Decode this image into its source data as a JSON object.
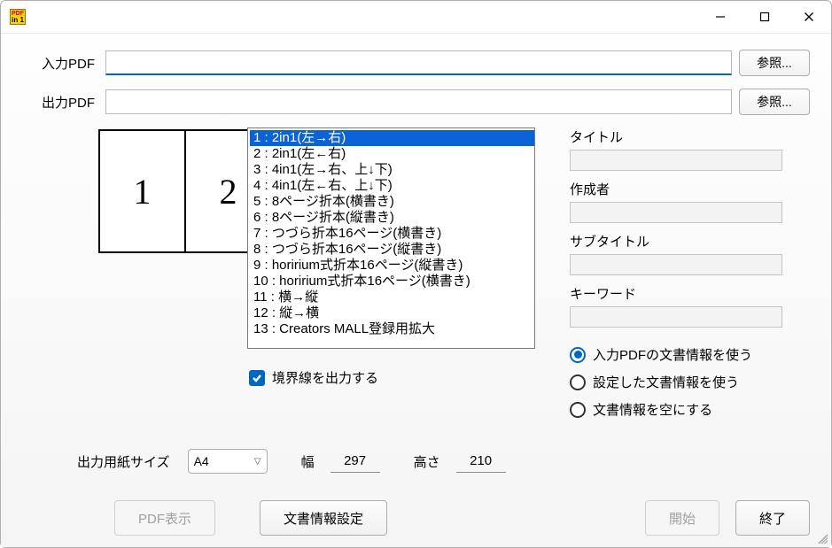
{
  "window": {
    "app_icon_top": "PDF",
    "app_icon_bottom": "in 1"
  },
  "file": {
    "input_label": "入力PDF",
    "output_label": "出力PDF",
    "input_value": "",
    "output_value": "",
    "browse_label": "参照..."
  },
  "preview": {
    "cells": [
      "1",
      "2"
    ]
  },
  "layouts": {
    "selected_index": 0,
    "items": [
      "1 : 2in1(左→右)",
      "2 : 2in1(左←右)",
      "3 : 4in1(左→右、上↓下)",
      "4 : 4in1(左←右、上↓下)",
      "5 : 8ページ折本(横書き)",
      "6 : 8ページ折本(縦書き)",
      "7 : つづら折本16ページ(横書き)",
      "8 : つづら折本16ページ(縦書き)",
      "9 : horirium式折本16ページ(縦書き)",
      "10 : horirium式折本16ページ(横書き)",
      "11 : 横→縦",
      "12 : 縦→横",
      "13 : Creators MALL登録用拡大"
    ]
  },
  "checkbox": {
    "border_output_label": "境界線を出力する",
    "checked": true
  },
  "paper": {
    "size_label": "出力用紙サイズ",
    "size_value": "A4",
    "width_label": "幅",
    "width_value": "297",
    "height_label": "高さ",
    "height_value": "210"
  },
  "meta": {
    "title_label": "タイトル",
    "title_value": "",
    "author_label": "作成者",
    "author_value": "",
    "subtitle_label": "サブタイトル",
    "subtitle_value": "",
    "keyword_label": "キーワード",
    "keyword_value": ""
  },
  "docinfo_radio": {
    "selected_index": 0,
    "options": [
      "入力PDFの文書情報を使う",
      "設定した文書情報を使う",
      "文書情報を空にする"
    ]
  },
  "buttons": {
    "pdf_view": "PDF表示",
    "doc_info_settings": "文書情報設定",
    "start": "開始",
    "exit": "終了"
  }
}
